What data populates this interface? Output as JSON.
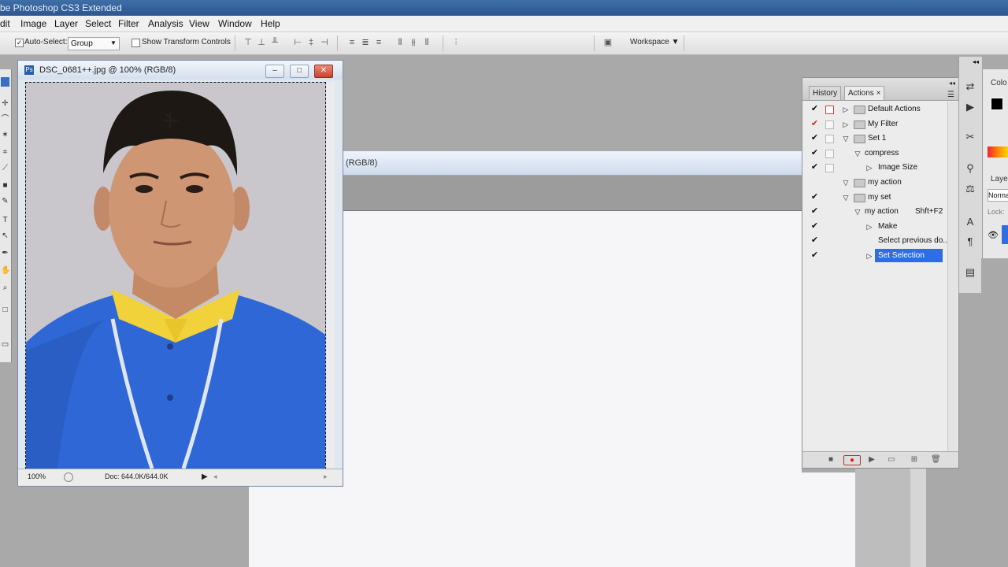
{
  "app": {
    "title": "be Photoshop CS3 Extended"
  },
  "menu": [
    "dit",
    "Image",
    "Layer",
    "Select",
    "Filter",
    "Analysis",
    "View",
    "Window",
    "Help"
  ],
  "options": {
    "auto_select_label": "Auto-Select:",
    "auto_select_checked": true,
    "group_value": "Group",
    "show_transform_label": "Show Transform Controls",
    "show_transform_checked": false,
    "workspace_label": "Workspace"
  },
  "photo_doc": {
    "title": "DSC_0681++.jpg @ 100% (RGB/8)",
    "zoom": "100%",
    "doc_size": "Doc: 644.0K/644.0K"
  },
  "bg_doc": {
    "title_fragment": "(RGB/8)"
  },
  "actions_panel": {
    "tabs": [
      "History",
      "Actions"
    ],
    "active_tab": "Actions",
    "rows": [
      {
        "label": "Default Actions",
        "checked": true,
        "dialog": "red",
        "level": 0,
        "type": "set",
        "expanded": false
      },
      {
        "label": "My Filter",
        "checked": true,
        "checkColor": "red",
        "dialog": "empty",
        "level": 0,
        "type": "set",
        "expanded": false
      },
      {
        "label": "Set 1",
        "checked": true,
        "dialog": "empty",
        "level": 0,
        "type": "set",
        "expanded": true
      },
      {
        "label": "compress",
        "checked": true,
        "dialog": "empty",
        "level": 1,
        "type": "action",
        "expanded": true
      },
      {
        "label": "Image Size",
        "checked": true,
        "dialog": "empty",
        "level": 2,
        "type": "step",
        "expanded": false
      },
      {
        "label": "my action",
        "checked": false,
        "dialog": "none",
        "level": 0,
        "type": "set",
        "expanded": true
      },
      {
        "label": "my set",
        "checked": true,
        "dialog": "none",
        "level": 0,
        "type": "set",
        "expanded": true
      },
      {
        "label": "my action",
        "checked": true,
        "dialog": "none",
        "level": 1,
        "type": "action",
        "expanded": true,
        "shortcut": "Shft+F2"
      },
      {
        "label": "Make",
        "checked": true,
        "dialog": "none",
        "level": 2,
        "type": "step",
        "expanded": false
      },
      {
        "label": "Select previous do...",
        "checked": true,
        "dialog": "none",
        "level": 2,
        "type": "step-plain",
        "expanded": false
      },
      {
        "label": "Set Selection",
        "checked": true,
        "dialog": "none",
        "level": 2,
        "type": "step",
        "expanded": false,
        "selected": true
      }
    ]
  },
  "right_panel": {
    "color_tab": "Colo",
    "layers_tab": "Layer",
    "blend": "Norma",
    "lock": "Lock:"
  },
  "colors": {
    "accent": "#2f6ee0",
    "titlebar": "#3f6fa8",
    "shirt": "#2f68d6",
    "collar": "#f2d23a"
  }
}
